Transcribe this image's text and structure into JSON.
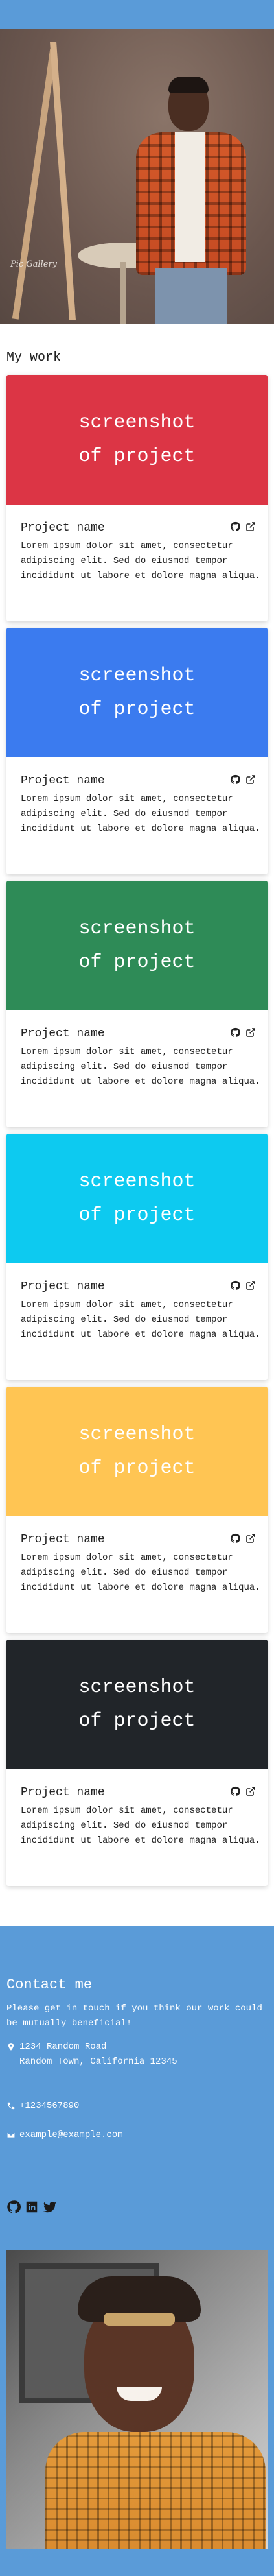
{
  "hero": {
    "signature": "Pic Gallery"
  },
  "work": {
    "title": "My work",
    "projects": [
      {
        "line1": "screenshot",
        "line2": "of project",
        "name": "Project name",
        "desc": "Lorem ipsum dolor sit amet, consectetur adipiscing elit. Sed do eiusmod tempor incididunt ut labore et dolore magna aliqua.",
        "color": "#dc3545"
      },
      {
        "line1": "screenshot",
        "line2": "of project",
        "name": "Project name",
        "desc": "Lorem ipsum dolor sit amet, consectetur adipiscing elit. Sed do eiusmod tempor incididunt ut labore et dolore magna aliqua.",
        "color": "#3b7bef"
      },
      {
        "line1": "screenshot",
        "line2": "of project",
        "name": "Project name",
        "desc": "Lorem ipsum dolor sit amet, consectetur adipiscing elit. Sed do eiusmod tempor incididunt ut labore et dolore magna aliqua.",
        "color": "#2e8b57"
      },
      {
        "line1": "screenshot",
        "line2": "of project",
        "name": "Project name",
        "desc": "Lorem ipsum dolor sit amet, consectetur adipiscing elit. Sed do eiusmod tempor incididunt ut labore et dolore magna aliqua.",
        "color": "#0dcaf0"
      },
      {
        "line1": "screenshot",
        "line2": "of project",
        "name": "Project name",
        "desc": "Lorem ipsum dolor sit amet, consectetur adipiscing elit. Sed do eiusmod tempor incididunt ut labore et dolore magna aliqua.",
        "color": "#ffc553"
      },
      {
        "line1": "screenshot",
        "line2": "of project",
        "name": "Project name",
        "desc": "Lorem ipsum dolor sit amet, consectetur adipiscing elit. Sed do eiusmod tempor incididunt ut labore et dolore magna aliqua.",
        "color": "#212529"
      }
    ]
  },
  "contact": {
    "title": "Contact me",
    "text": "Please get in touch if you think our work could be mutually beneficial!",
    "address_line1": "1234 Random Road",
    "address_line2": "Random Town, California 12345",
    "phone": "+1234567890",
    "email": "example@example.com",
    "icons": [
      "map-marker-icon",
      "phone-icon",
      "envelope-icon",
      "github-icon",
      "linkedin-icon",
      "twitter-icon"
    ]
  },
  "colors": {
    "accent": "#5a9bd8",
    "card_text": "#222222"
  }
}
